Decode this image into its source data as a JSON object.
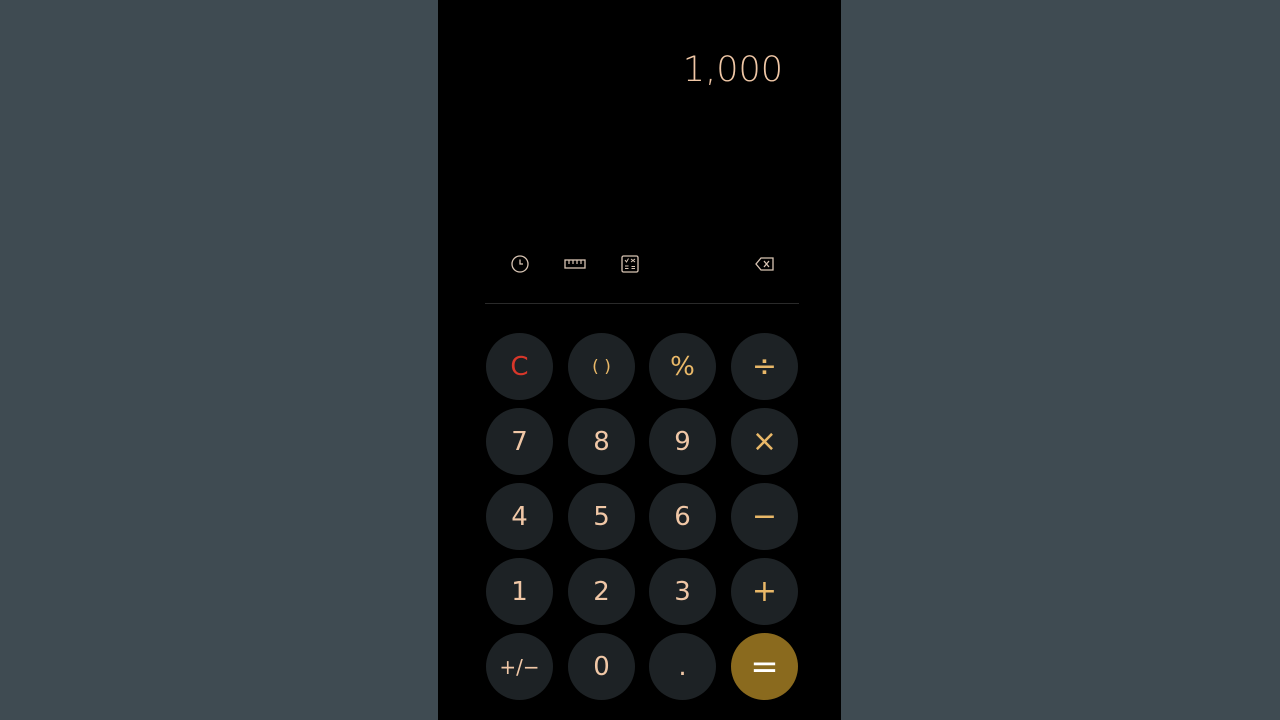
{
  "display": {
    "value": "1,000"
  },
  "toolbar": {
    "history_icon": "clock-icon",
    "unit_converter_icon": "ruler-icon",
    "scientific_icon": "scientific-calc-icon",
    "backspace_icon": "backspace-icon"
  },
  "keys": {
    "row1": [
      "C",
      "( )",
      "%",
      "÷"
    ],
    "row2": [
      "7",
      "8",
      "9",
      "×"
    ],
    "row3": [
      "4",
      "5",
      "6",
      "−"
    ],
    "row4": [
      "1",
      "2",
      "3",
      "+"
    ],
    "row5": [
      "+/−",
      "0",
      ".",
      "="
    ]
  },
  "colors": {
    "background_side": "#3f4b52",
    "phone_bg": "#000000",
    "key_bg": "#1d2225",
    "digit": "#f0c7a6",
    "operator": "#e9b868",
    "clear": "#d8372a",
    "equals_bg": "#8a6a1e"
  }
}
